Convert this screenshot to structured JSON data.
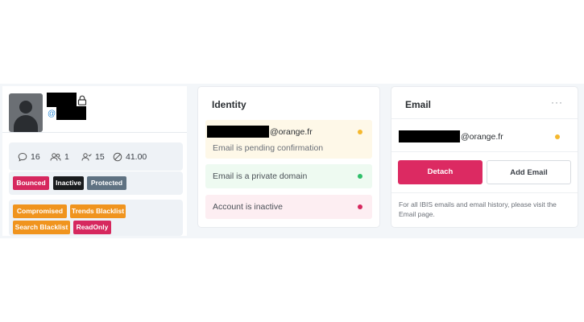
{
  "profile": {
    "at_symbol": "@",
    "stats": [
      {
        "icon": "comment-icon",
        "value": "16"
      },
      {
        "icon": "users-icon",
        "value": "1"
      },
      {
        "icon": "user-check-icon",
        "value": "15"
      },
      {
        "icon": "ban-icon",
        "value": "41.00"
      }
    ],
    "status_tags": [
      "Bounced",
      "Inactive",
      "Protected"
    ],
    "flag_tags": [
      "Compromised",
      "Trends Blacklist",
      "Search Blacklist",
      "ReadOnly"
    ]
  },
  "identity": {
    "title": "Identity",
    "email_domain": "@orange.fr",
    "pending_text": "Email is pending confirmation",
    "private_text": "Email is a private domain",
    "inactive_text": "Account is inactive"
  },
  "email": {
    "title": "Email",
    "more_label": "···",
    "email_domain": "@orange.fr",
    "detach_label": "Detach",
    "add_label": "Add Email",
    "note_line1": "For all IBIS emails and email history, please visit the",
    "note_line2": "Email page."
  },
  "colors": {
    "warning": "#f5b82e",
    "success": "#2fbf6a",
    "danger": "#d6285e"
  }
}
